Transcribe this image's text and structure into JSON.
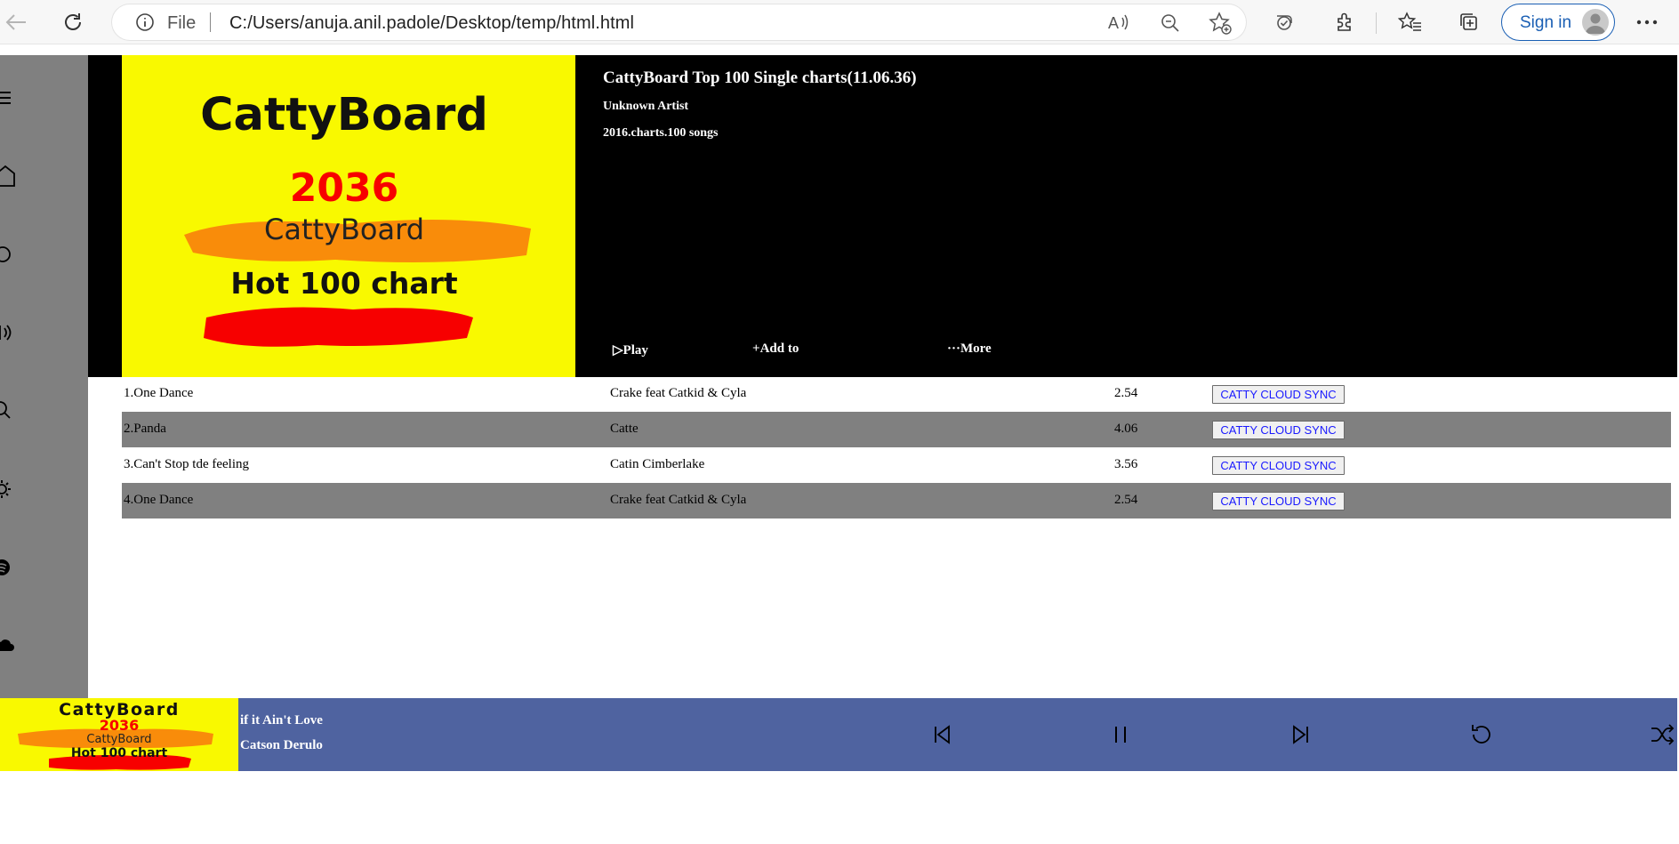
{
  "browser": {
    "file_label": "File",
    "url": "C:/Users/anuja.anil.padole/Desktop/temp/html.html",
    "signin_label": "Sign in"
  },
  "sidebar": {
    "icons": [
      "menu-icon",
      "home-icon",
      "circle-icon",
      "podcast-icon",
      "search-icon",
      "settings-icon",
      "spotify-icon",
      "cloud-icon"
    ]
  },
  "header": {
    "cover": {
      "brand": "CattyBoard",
      "year": "2036",
      "sub_brand": "CattyBoard",
      "tagline": "Hot 100 chart"
    },
    "title": "CattyBoard Top 100 Single charts(11.06.36)",
    "artist": "Unknown Artist",
    "meta": "2016.charts.100 songs",
    "play_icon": "▷",
    "play_label": "Play",
    "add_icon": "+",
    "add_label": "Add to",
    "more_icon": "···",
    "more_label": "More"
  },
  "songs": [
    {
      "title": "1.One Dance",
      "artist": "Crake feat Catkid & Cyla",
      "duration": "2.54",
      "sync_label": "CATTY CLOUD SYNC"
    },
    {
      "title": "2.Panda",
      "artist": "Catte",
      "duration": "4.06",
      "sync_label": "CATTY CLOUD SYNC"
    },
    {
      "title": "3.Can't Stop tde feeling",
      "artist": "Catin Cimberlake",
      "duration": "3.56",
      "sync_label": "CATTY CLOUD SYNC"
    },
    {
      "title": "4.One Dance",
      "artist": "Crake feat Catkid & Cyla",
      "duration": "2.54",
      "sync_label": "CATTY CLOUD SYNC"
    }
  ],
  "player": {
    "cover": {
      "brand": "CattyBoard",
      "year": "2036",
      "sub_brand": "CattyBoard",
      "tagline": "Hot 100 chart"
    },
    "title": "if it Ain't Love",
    "artist": "Catson Derulo",
    "controls": [
      "previous-icon",
      "pause-icon",
      "next-icon",
      "repeat-icon",
      "shuffle-icon"
    ]
  },
  "colors": {
    "sidebar": "#808080",
    "header_bg": "#000000",
    "cover_bg": "#f9f900",
    "player_bg": "#4f63a0",
    "alt_row": "#808080",
    "sync_text": "#1a1aff"
  }
}
